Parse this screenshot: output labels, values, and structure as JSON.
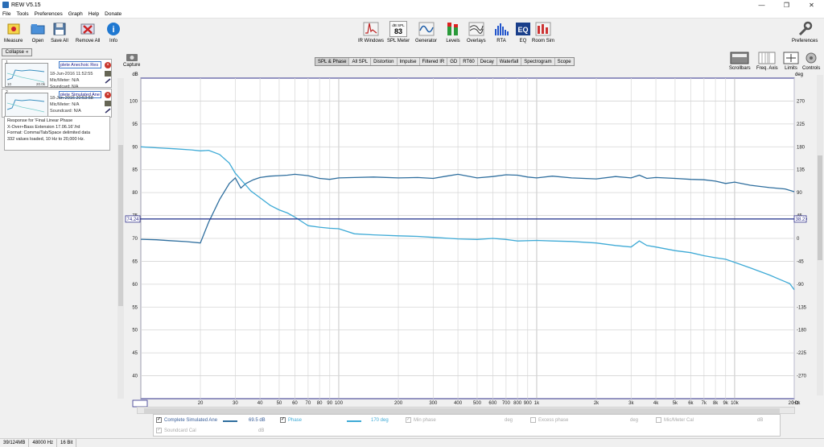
{
  "window": {
    "title": "REW V5.15"
  },
  "menu": [
    "File",
    "Tools",
    "Preferences",
    "Graph",
    "Help",
    "Donate"
  ],
  "toolbar_left": [
    {
      "label": "Measure",
      "icon": "microphone-icon"
    },
    {
      "label": "Open",
      "icon": "folder-open-icon"
    },
    {
      "label": "Save All",
      "icon": "save-icon"
    },
    {
      "label": "Remove All",
      "icon": "remove-all-icon"
    },
    {
      "label": "Info",
      "icon": "info-icon"
    }
  ],
  "toolbar_center": [
    {
      "label": "IR Windows",
      "icon": "ir-windows-icon"
    },
    {
      "label": "SPL Meter",
      "icon": "spl-meter-icon"
    },
    {
      "label": "Generator",
      "icon": "generator-icon"
    },
    {
      "label": "Levels",
      "icon": "levels-icon"
    },
    {
      "label": "Overlays",
      "icon": "overlays-icon"
    },
    {
      "label": "RTA",
      "icon": "rta-icon"
    },
    {
      "label": "EQ",
      "icon": "eq-icon"
    },
    {
      "label": "Room Sim",
      "icon": "room-sim-icon"
    }
  ],
  "spl_meter": {
    "unit": "dB SPL",
    "value": "83"
  },
  "toolbar_right": {
    "label": "Preferences",
    "icon": "wrench-icon"
  },
  "left_panel": {
    "collapse_label": "Collapse",
    "measurements": [
      {
        "number": "1",
        "name": "plete Anechoic Res",
        "date": "18-Jun-2016 11:52:55",
        "mic": "Mic/Meter: N/A",
        "soundcard": "Soundcard: N/A"
      },
      {
        "number": "2",
        "name": "plete Simulated Ane",
        "date": "18-Jun-2016 20:53:58",
        "mic": "Mic/Meter: N/A",
        "soundcard": "Soundcard: N/A"
      }
    ],
    "thumb_freq_label": "20.0k",
    "notes": [
      "Response for 'Final Linear Phase",
      "X-Over+Bass Extension 17.06.16'.frd",
      "Format: Comma/Tab/Space delimited data",
      "332 values loaded, 10 Hz to 20,000 Hz."
    ]
  },
  "capture_label": "Capture",
  "graph_tabs": [
    "SPL & Phase",
    "All SPL",
    "Distortion",
    "Impulse",
    "Filtered IR",
    "GD",
    "RT60",
    "Decay",
    "Waterfall",
    "Spectrogram",
    "Scope"
  ],
  "active_tab": "SPL & Phase",
  "graph_tools": [
    {
      "label": "Scrollbars",
      "icon": "scrollbars-icon"
    },
    {
      "label": "Freq. Axis",
      "icon": "freq-axis-icon"
    },
    {
      "label": "Limits",
      "icon": "limits-icon"
    },
    {
      "label": "Controls",
      "icon": "controls-icon"
    }
  ],
  "chart_data": {
    "type": "line",
    "x_scale": "log",
    "xlim": [
      10,
      20000
    ],
    "ylim": [
      35,
      105
    ],
    "y2lim": [
      -315,
      315
    ],
    "ylabel": "dB",
    "y2label": "deg",
    "xunit": "Hz",
    "grid": true,
    "x_ticks": [
      "10.00",
      "20",
      "30",
      "40",
      "50",
      "60",
      "70",
      "80",
      "90",
      "100",
      "200",
      "300",
      "400",
      "500",
      "600",
      "700",
      "800",
      "900",
      "1k",
      "2k",
      "3k",
      "4k",
      "5k",
      "6k",
      "7k",
      "8k",
      "9k",
      "10k",
      "20.0k"
    ],
    "y_ticks": [
      40,
      45,
      50,
      55,
      60,
      65,
      70,
      75,
      80,
      85,
      90,
      95,
      100
    ],
    "y2_ticks": [
      -270,
      -225,
      -180,
      -135,
      -90,
      -45,
      0,
      45,
      90,
      135,
      180,
      225,
      270
    ],
    "cursor": {
      "db_label": "74.24",
      "deg_label": "38.2"
    },
    "series": [
      {
        "name": "Complete Simulated Ane",
        "axis": "left",
        "color": "#2e6e9e",
        "x": [
          10,
          12,
          14,
          17,
          20,
          22,
          25,
          28,
          30,
          32,
          34,
          37,
          40,
          45,
          50,
          55,
          60,
          70,
          80,
          90,
          100,
          120,
          150,
          200,
          250,
          300,
          350,
          400,
          500,
          600,
          700,
          800,
          900,
          1000,
          1200,
          1500,
          2000,
          2500,
          3000,
          3300,
          3600,
          4000,
          5000,
          6000,
          7000,
          8000,
          9000,
          10000,
          12000,
          15000,
          18000,
          20000
        ],
        "y": [
          69.8,
          69.7,
          69.5,
          69.3,
          69.0,
          73.5,
          78.5,
          82.0,
          83.2,
          81.0,
          82.0,
          82.8,
          83.3,
          83.6,
          83.7,
          83.8,
          84.0,
          83.7,
          83.1,
          82.9,
          83.2,
          83.3,
          83.4,
          83.2,
          83.3,
          83.1,
          83.6,
          84.0,
          83.2,
          83.5,
          83.9,
          83.8,
          83.4,
          83.2,
          83.6,
          83.2,
          83.0,
          83.5,
          83.2,
          83.8,
          83.1,
          83.3,
          83.1,
          82.9,
          82.8,
          82.5,
          82.0,
          82.3,
          81.6,
          81.1,
          80.8,
          80.2
        ]
      },
      {
        "name": "Phase",
        "axis": "right",
        "color": "#3eaad6",
        "x": [
          10,
          12,
          15,
          18,
          20,
          22,
          25,
          28,
          30,
          33,
          36,
          40,
          45,
          50,
          55,
          60,
          70,
          80,
          90,
          100,
          120,
          150,
          200,
          250,
          300,
          400,
          500,
          600,
          700,
          800,
          1000,
          1200,
          1500,
          2000,
          2500,
          3000,
          3300,
          3600,
          4000,
          5000,
          6000,
          7000,
          8000,
          9000,
          10000,
          12000,
          15000,
          17000,
          19000,
          20000
        ],
        "y": [
          180,
          178,
          176,
          174,
          172,
          173,
          165,
          148,
          128,
          110,
          93,
          80,
          65,
          56,
          50,
          42,
          25,
          22,
          20,
          19,
          9,
          7,
          5,
          4,
          2,
          -1,
          -2,
          0,
          -2,
          -5,
          -4,
          -5,
          -6,
          -9,
          -14,
          -17,
          -5,
          -14,
          -17,
          -24,
          -28,
          -34,
          -38,
          -41,
          -47,
          -58,
          -72,
          -81,
          -89,
          -101
        ]
      }
    ]
  },
  "legend": {
    "row1": [
      {
        "label": "Complete Simulated Ane",
        "checked": true,
        "enabled": true,
        "color": "#2e6e9e",
        "value": "69.5 dB"
      },
      {
        "label": "Phase",
        "checked": true,
        "enabled": true,
        "color": "#3eaad6",
        "value": "170 deg"
      },
      {
        "label": "Min phase",
        "checked": true,
        "enabled": false,
        "value": "deg"
      },
      {
        "label": "Excess phase",
        "checked": false,
        "enabled": false,
        "value": "deg"
      },
      {
        "label": "Mic/Meter Cal",
        "checked": false,
        "enabled": false,
        "value": "dB"
      }
    ],
    "row2": [
      {
        "label": "Soundcard Cal",
        "checked": true,
        "enabled": false,
        "value": "dB"
      }
    ]
  },
  "status": [
    "39/124MB",
    "48000 Hz",
    "16 Bit"
  ]
}
